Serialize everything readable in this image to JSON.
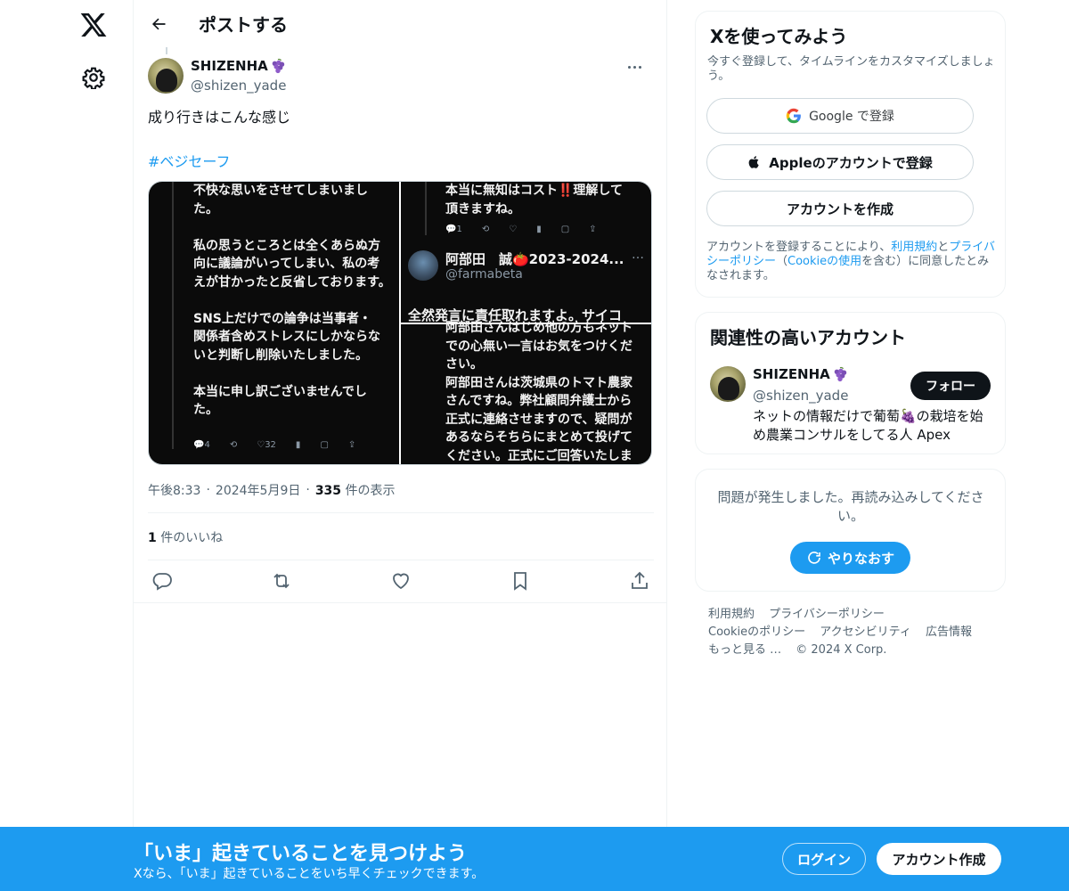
{
  "nav": {
    "logo_icon": "x-logo-icon",
    "settings_icon": "gear-icon"
  },
  "header": {
    "title": "ポストする",
    "back_icon": "arrow-left-icon"
  },
  "post": {
    "author_name": "SHIZENHA",
    "author_emoji": "grape-icon",
    "author_handle": "@shizen_yade",
    "text": "成り行きはこんな感じ",
    "hashtag": "#ベジセーフ",
    "time": "午後8:33",
    "date": "2024年5月9日",
    "views_count": "335",
    "views_label": " 件の表示",
    "likes_count": "1",
    "likes_label": " 件のいいね",
    "media": {
      "img1_text": "不快な思いをさせてしまいまし\nた。\n\n私の思うところとは全くあらぬ方\n向に議論がいってしまい、私の考\nえが甘かったと反省しております。\n\nSNS上だけでの論争は当事者・\n関係者含めストレスにしかならな\nいと判断し削除いたしました。\n\n本当に申し訳ございませんでし\nた。",
      "img1_actions": [
        "4",
        "",
        "32",
        "",
        "",
        ""
      ],
      "img2_text": "本当に無知はコスト‼️理解して\n頂きますね。",
      "img2_user": "阿部田　誠🍅2023-2024...",
      "img2_handle": "@farmabeta",
      "img2_dots": "…",
      "img2_bottom": "全然発言に責任取れますよ。サイコ",
      "img3_text": "阿部田さんはじめ他の方もネット\nでの心無い一言はお気をつけくだ\nさい。\n阿部田さんは茨城県のトマト農家\nさんですね。弊社顧問弁護士から\n正式に連絡させますので、疑問が\nあるならそちらにまとめて投げて\nください。正式にご回答いたしま"
    }
  },
  "signup_card": {
    "title": "Xを使ってみよう",
    "subtitle": "今すぐ登録して、タイムラインをカスタマイズしましょう。",
    "google_label": "Google で登録",
    "apple_label": "Appleのアカウントで登録",
    "create_label": "アカウントを作成",
    "legal_prefix": "アカウントを登録することにより、",
    "legal_terms": "利用規約",
    "legal_and": "と",
    "legal_privacy": "プライバシーポリシー",
    "legal_open": "（",
    "legal_cookie": "Cookieの使用",
    "legal_suffix": "を含む）に同意したとみなされます。"
  },
  "related": {
    "title": "関連性の高いアカウント",
    "name": "SHIZENHA",
    "handle": "@shizen_yade",
    "bio": "ネットの情報だけで葡萄🍇の栽培を始め農業コンサルをしてる人 Apex",
    "follow_label": "フォロー"
  },
  "error_card": {
    "message": "問題が発生しました。再読み込みしてください。",
    "retry_label": "やりなおす"
  },
  "footer": {
    "terms": "利用規約",
    "privacy": "プライバシーポリシー",
    "cookie": "Cookieのポリシー",
    "accessibility": "アクセシビリティ",
    "ads": "広告情報",
    "more": "もっと見る …",
    "copyright": "© 2024 X Corp."
  },
  "bottom_bar": {
    "heading": "「いま」起きていることを見つけよう",
    "subtext": "Xなら、「いま」起きていることをいち早くチェックできます。",
    "login_label": "ログイン",
    "signup_label": "アカウント作成"
  },
  "colors": {
    "accent": "#1d9bf0",
    "text": "#0f1419",
    "muted": "#536471"
  }
}
